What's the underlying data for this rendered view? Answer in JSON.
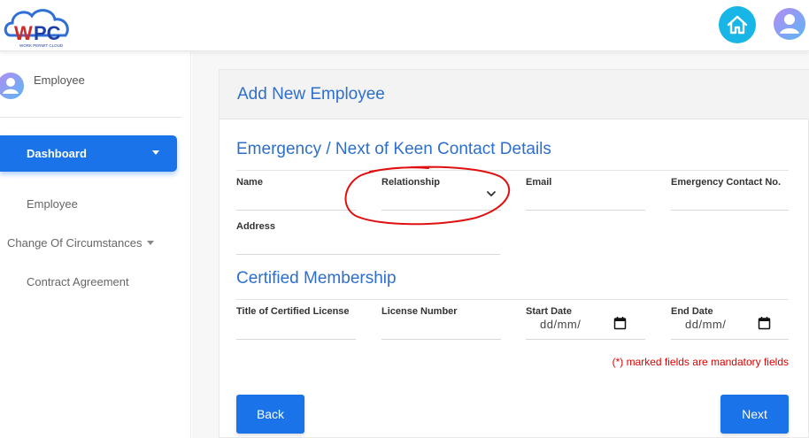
{
  "header": {
    "logo_text": "WPC",
    "logo_subtext": "WORK PERMIT CLOUD",
    "home_icon": "home-icon",
    "user_icon": "user-avatar-icon",
    "brand_color": "#17b6e6",
    "accent_color": "#1a73e8"
  },
  "sidebar": {
    "user_label": "Employee",
    "dashboard_label": "Dashboard",
    "items": [
      {
        "label": "Employee"
      },
      {
        "label": "Change Of Circumstances"
      },
      {
        "label": "Contract Agreement"
      }
    ]
  },
  "card": {
    "title": "Add New Employee"
  },
  "emergency": {
    "title": "Emergency / Next of Keen Contact Details",
    "fields": {
      "name": {
        "label": "Name",
        "value": ""
      },
      "relationship": {
        "label": "Relationship",
        "value": ""
      },
      "email": {
        "label": "Email",
        "value": ""
      },
      "contact": {
        "label": "Emergency Contact No.",
        "value": ""
      },
      "address": {
        "label": "Address",
        "value": ""
      }
    }
  },
  "membership": {
    "title": "Certified Membership",
    "fields": {
      "license_title": {
        "label": "Title of Certified License",
        "value": ""
      },
      "license_number": {
        "label": "License Number",
        "value": ""
      },
      "start_date": {
        "label": "Start Date",
        "value": "dd/mm/"
      },
      "end_date": {
        "label": "End Date",
        "value": "dd/mm/"
      }
    }
  },
  "footer": {
    "mandatory_note": "(*) marked fields are mandatory fields",
    "mandatory_color": "#e00000",
    "back_label": "Back",
    "next_label": "Next"
  }
}
